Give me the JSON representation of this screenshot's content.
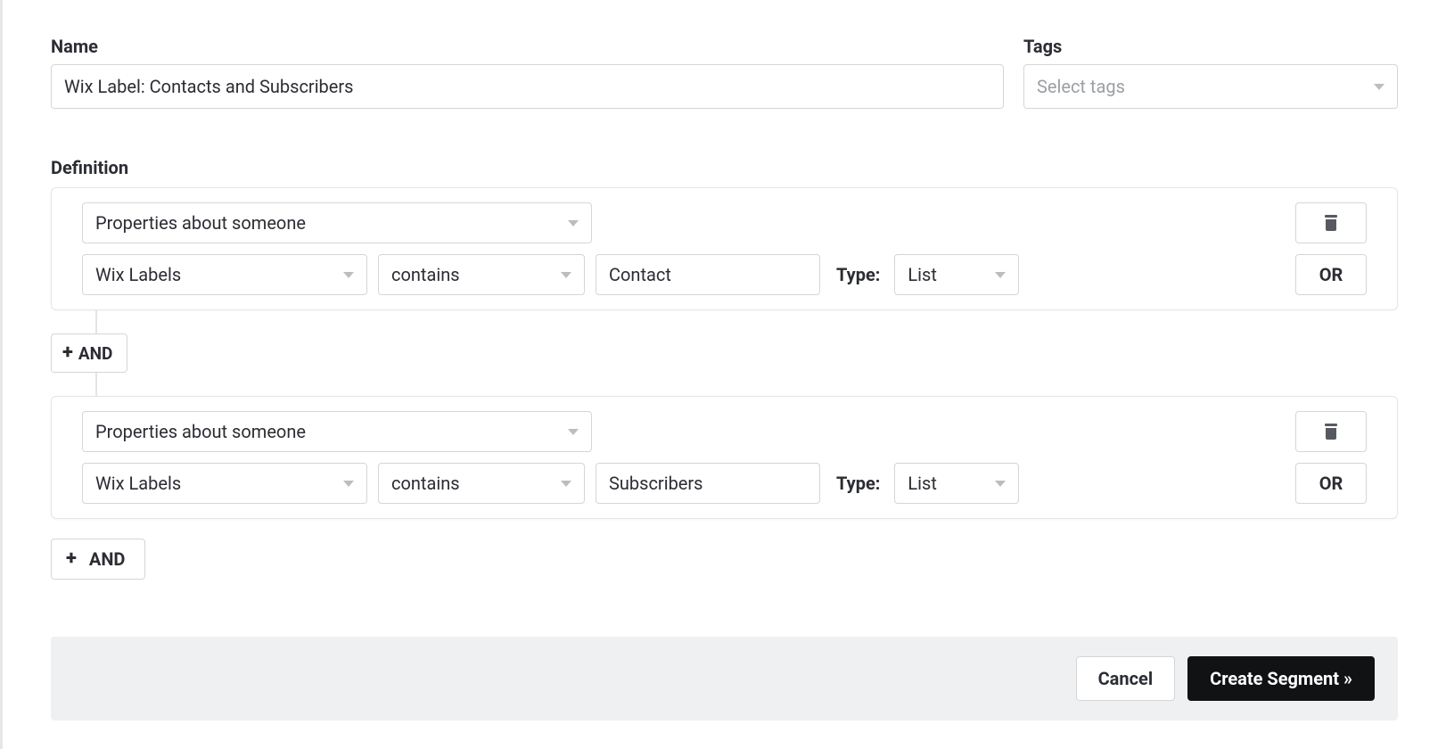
{
  "labels": {
    "name": "Name",
    "tags": "Tags",
    "definition": "Definition",
    "type": "Type:"
  },
  "form": {
    "name_value": "Wix Label: Contacts and Subscribers",
    "tags_placeholder": "Select tags"
  },
  "blocks": [
    {
      "source": "Properties about someone",
      "property": "Wix Labels",
      "operator": "contains",
      "value": "Contact",
      "type": "List",
      "or_label": "OR"
    },
    {
      "source": "Properties about someone",
      "property": "Wix Labels",
      "operator": "contains",
      "value": "Subscribers",
      "type": "List",
      "or_label": "OR"
    }
  ],
  "connectors": {
    "and_pill": "AND",
    "add_and": "AND"
  },
  "footer": {
    "cancel": "Cancel",
    "create": "Create Segment »"
  }
}
